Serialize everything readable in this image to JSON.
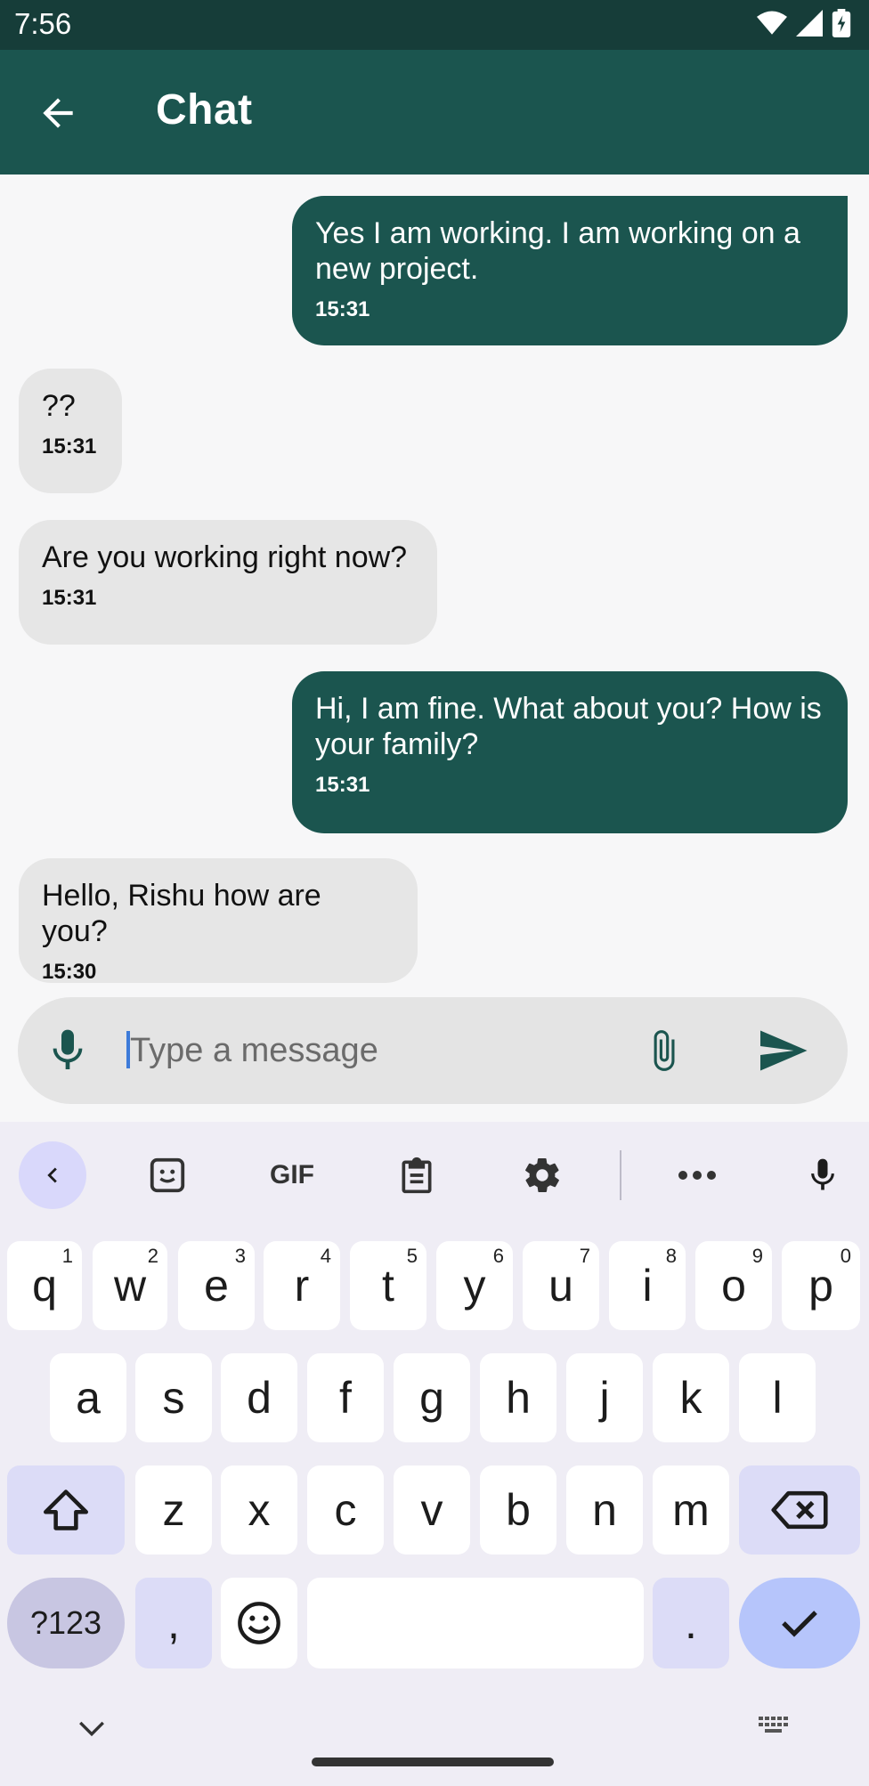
{
  "status_bar": {
    "time": "7:56"
  },
  "app_bar": {
    "title": "Chat"
  },
  "messages": [
    {
      "direction": "out",
      "text": "Yes I am working. I am working on a new project.",
      "time": "15:31"
    },
    {
      "direction": "in",
      "text": "??",
      "time": "15:31"
    },
    {
      "direction": "in",
      "text": "Are you working right now?",
      "time": "15:31"
    },
    {
      "direction": "out",
      "text": "Hi, I am fine. What about you? How is your family?",
      "time": "15:31"
    },
    {
      "direction": "in",
      "text": "Hello, Rishu how are you?",
      "time": "15:30"
    }
  ],
  "composer": {
    "placeholder": "Type a message",
    "value": ""
  },
  "keyboard": {
    "toolbar": [
      "collapse-icon",
      "sticker-icon",
      "gif-icon",
      "clipboard-icon",
      "settings-icon",
      "more-icon",
      "voice-icon"
    ],
    "gif_label": "GIF",
    "row1": [
      {
        "k": "q",
        "s": "1"
      },
      {
        "k": "w",
        "s": "2"
      },
      {
        "k": "e",
        "s": "3"
      },
      {
        "k": "r",
        "s": "4"
      },
      {
        "k": "t",
        "s": "5"
      },
      {
        "k": "y",
        "s": "6"
      },
      {
        "k": "u",
        "s": "7"
      },
      {
        "k": "i",
        "s": "8"
      },
      {
        "k": "o",
        "s": "9"
      },
      {
        "k": "p",
        "s": "0"
      }
    ],
    "row2": [
      "a",
      "s",
      "d",
      "f",
      "g",
      "h",
      "j",
      "k",
      "l"
    ],
    "row3": [
      "z",
      "x",
      "c",
      "v",
      "b",
      "n",
      "m"
    ],
    "sym_label": "?123",
    "comma": ",",
    "period": ".",
    "colors": {
      "accent": "#1b554f",
      "status": "#163d39"
    }
  }
}
